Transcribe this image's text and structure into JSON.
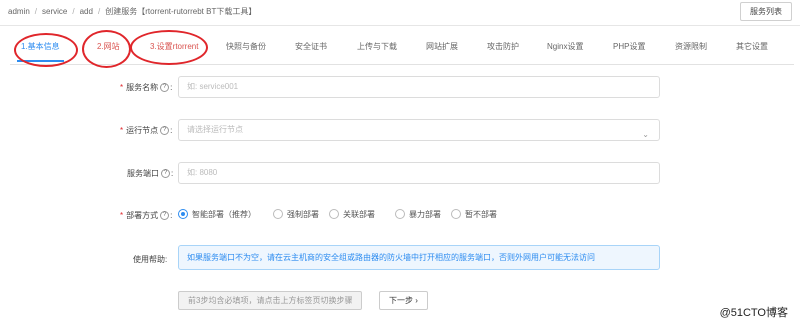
{
  "breadcrumb": {
    "items": [
      "admin",
      "service",
      "add",
      "创建服务【rtorrent-rutorrebt BT下载工具】"
    ],
    "separator": "/"
  },
  "header": {
    "list_button": "服务列表"
  },
  "tabs": [
    "1.基本信息",
    "2.网站",
    "3.设置rtorrent",
    "快照与备份",
    "安全证书",
    "上传与下载",
    "网站扩展",
    "攻击防护",
    "Nginx设置",
    "PHP设置",
    "资源限制",
    "其它设置"
  ],
  "form": {
    "service_name": {
      "label": "服务名称",
      "placeholder": "如: service001",
      "required": true
    },
    "run_node": {
      "label": "运行节点",
      "placeholder": "请选择运行节点",
      "required": true
    },
    "service_port": {
      "label": "服务端口",
      "placeholder": "如: 8080",
      "required": false
    },
    "deploy_mode": {
      "label": "部署方式",
      "required": true,
      "options": [
        "智能部署（推荐）",
        "强制部署",
        "关联部署",
        "暴力部署",
        "暂不部署"
      ],
      "selected": "智能部署（推荐）"
    },
    "usage_help": {
      "label": "使用帮助:",
      "text": "如果服务端口不为空，请在云主机商的安全组或路由器的防火墙中打开相应的服务端口，否则外网用户可能无法访问"
    }
  },
  "actions": {
    "hint_button": "前3步均含必填项，请点击上方标签页切换步骤",
    "next_button": "下一步 ›"
  },
  "watermark": "@51CTO博客",
  "colors": {
    "accent": "#2d8cf0",
    "annotation_red": "#e0262b"
  }
}
